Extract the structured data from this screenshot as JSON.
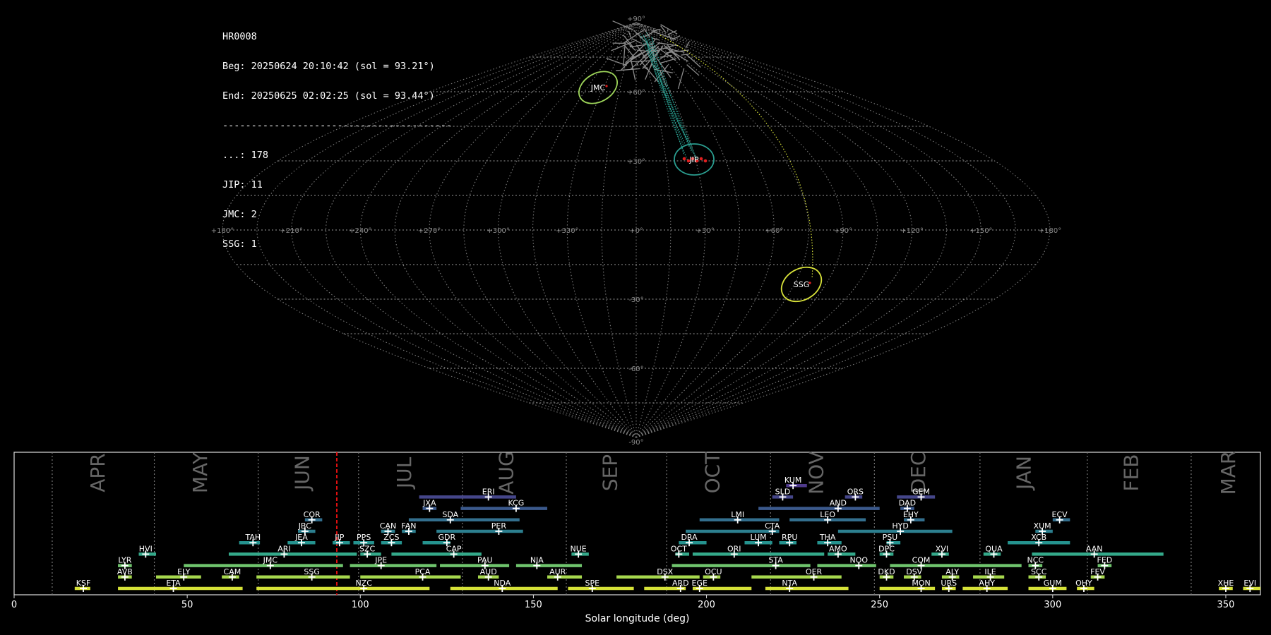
{
  "info": {
    "station": "HR0008",
    "begin": "Beg: 20250624 20:10:42 (sol = 93.21°)",
    "end": "End: 20250625 02:02:25 (sol = 93.44°)",
    "separator": "----------------------------------------",
    "counts": [
      "...: 178",
      "JIP: 11",
      "JMC: 2",
      "SSG: 1"
    ]
  },
  "chart_data": [
    {
      "type": "scatter",
      "projection": "sinusoidal",
      "lon_tick_labels": [
        "+180°",
        "+150°",
        "+120°",
        "+90°",
        "+60°",
        "+30°",
        "+0°",
        "+330°",
        "+300°",
        "+270°",
        "+240°",
        "+210°",
        "+180°"
      ],
      "lat_tick_labels": [
        "+90°",
        "+60°",
        "+30°",
        "-30°",
        "-60°",
        "-90°"
      ],
      "grid": true,
      "showers": [
        {
          "code": "JMC",
          "lon": 52,
          "lat": 60,
          "color": "#9ed65a"
        },
        {
          "code": "JIP",
          "lon": -18,
          "lat": 31,
          "color": "#2a9d8f"
        },
        {
          "code": "SSG",
          "lon": -72,
          "lat": -27,
          "color": "#d8e23a"
        }
      ]
    },
    {
      "type": "bar",
      "orientation": "horizontal-ranges",
      "xlabel": "Solar longitude (deg)",
      "xlim": [
        0,
        360
      ],
      "x_ticks": [
        0,
        50,
        100,
        150,
        200,
        250,
        300,
        350
      ],
      "current_sol": 93.21,
      "months": [
        {
          "name": "APR",
          "pos": 24.5
        },
        {
          "name": "MAY",
          "pos": 54
        },
        {
          "name": "JUN",
          "pos": 83.5
        },
        {
          "name": "JUL",
          "pos": 113
        },
        {
          "name": "AUG",
          "pos": 142.5
        },
        {
          "name": "SEP",
          "pos": 172.5
        },
        {
          "name": "OCT",
          "pos": 202
        },
        {
          "name": "NOV",
          "pos": 232
        },
        {
          "name": "DEC",
          "pos": 261.5
        },
        {
          "name": "JAN",
          "pos": 292
        },
        {
          "name": "FEB",
          "pos": 323
        },
        {
          "name": "MAR",
          "pos": 351
        }
      ],
      "month_boundaries": [
        11,
        40.5,
        70.5,
        99.5,
        129.5,
        159.5,
        188.5,
        218.5,
        248.5,
        279,
        310,
        340
      ],
      "showers": [
        {
          "code": "KSF",
          "start": 17.5,
          "end": 22,
          "peak": 20,
          "row": 0
        },
        {
          "code": "ETA",
          "start": 30,
          "end": 66,
          "peak": 46,
          "row": 0
        },
        {
          "code": "NZC",
          "start": 70,
          "end": 120,
          "peak": 101,
          "row": 0
        },
        {
          "code": "NDA",
          "start": 126,
          "end": 157,
          "peak": 141,
          "row": 0
        },
        {
          "code": "SPE",
          "start": 160,
          "end": 179,
          "peak": 167,
          "row": 0
        },
        {
          "code": "ARD",
          "start": 182,
          "end": 194,
          "peak": 192.5,
          "row": 0
        },
        {
          "code": "EGE",
          "start": 196,
          "end": 213,
          "peak": 198,
          "row": 0
        },
        {
          "code": "NTA",
          "start": 217,
          "end": 241,
          "peak": 224,
          "row": 0
        },
        {
          "code": "MON",
          "start": 250,
          "end": 266,
          "peak": 262,
          "row": 0
        },
        {
          "code": "URS",
          "start": 268,
          "end": 272,
          "peak": 270,
          "row": 0
        },
        {
          "code": "AHY",
          "start": 274,
          "end": 287,
          "peak": 281,
          "row": 0
        },
        {
          "code": "GUM",
          "start": 293,
          "end": 304,
          "peak": 300,
          "row": 0
        },
        {
          "code": "OHY",
          "start": 307,
          "end": 312,
          "peak": 309,
          "row": 0
        },
        {
          "code": "XHE",
          "start": 348,
          "end": 352,
          "peak": 350,
          "row": 0
        },
        {
          "code": "EVI",
          "start": 355,
          "end": 360,
          "peak": 357,
          "row": 0
        },
        {
          "code": "AVB",
          "start": 30,
          "end": 34,
          "peak": 32,
          "row": 1
        },
        {
          "code": "ELY",
          "start": 41,
          "end": 54,
          "peak": 49,
          "row": 1
        },
        {
          "code": "CAM",
          "start": 60,
          "end": 65,
          "peak": 63,
          "row": 1
        },
        {
          "code": "SSG",
          "start": 70,
          "end": 97,
          "peak": 86,
          "row": 1
        },
        {
          "code": "PCA",
          "start": 100,
          "end": 129,
          "peak": 118,
          "row": 1
        },
        {
          "code": "AUD",
          "start": 134,
          "end": 140,
          "peak": 137,
          "row": 1
        },
        {
          "code": "AUR",
          "start": 154,
          "end": 164,
          "peak": 157,
          "row": 1
        },
        {
          "code": "DSX",
          "start": 174,
          "end": 198,
          "peak": 188,
          "row": 1
        },
        {
          "code": "OCU",
          "start": 199,
          "end": 204,
          "peak": 202,
          "row": 1
        },
        {
          "code": "OER",
          "start": 213,
          "end": 239,
          "peak": 231,
          "row": 1
        },
        {
          "code": "DKD",
          "start": 250,
          "end": 254,
          "peak": 252,
          "row": 1
        },
        {
          "code": "DSV",
          "start": 257,
          "end": 262,
          "peak": 260,
          "row": 1
        },
        {
          "code": "ALY",
          "start": 268,
          "end": 273,
          "peak": 271,
          "row": 1
        },
        {
          "code": "ILE",
          "start": 277,
          "end": 286,
          "peak": 282,
          "row": 1
        },
        {
          "code": "SCC",
          "start": 293,
          "end": 298,
          "peak": 296,
          "row": 1
        },
        {
          "code": "FEV",
          "start": 311,
          "end": 315,
          "peak": 313,
          "row": 1
        },
        {
          "code": "LYR",
          "start": 30,
          "end": 34,
          "peak": 32,
          "row": 2
        },
        {
          "code": "JMC",
          "start": 49,
          "end": 95,
          "peak": 74,
          "row": 2
        },
        {
          "code": "JPE",
          "start": 97,
          "end": 122,
          "peak": 106,
          "row": 2
        },
        {
          "code": "PAU",
          "start": 123,
          "end": 143,
          "peak": 136,
          "row": 2
        },
        {
          "code": "NIA",
          "start": 145,
          "end": 164,
          "peak": 151,
          "row": 2
        },
        {
          "code": "STA",
          "start": 190,
          "end": 230,
          "peak": 220,
          "row": 2
        },
        {
          "code": "NOO",
          "start": 232,
          "end": 249,
          "peak": 244,
          "row": 2
        },
        {
          "code": "COM",
          "start": 253,
          "end": 291,
          "peak": 262,
          "row": 2
        },
        {
          "code": "NCC",
          "start": 293,
          "end": 297,
          "peak": 295,
          "row": 2
        },
        {
          "code": "FED",
          "start": 313,
          "end": 317,
          "peak": 315,
          "row": 2
        },
        {
          "code": "HVI",
          "start": 36,
          "end": 41,
          "peak": 38,
          "row": 3
        },
        {
          "code": "ARI",
          "start": 62,
          "end": 99,
          "peak": 78,
          "row": 3
        },
        {
          "code": "SZC",
          "start": 100,
          "end": 106,
          "peak": 102,
          "row": 3
        },
        {
          "code": "CAP",
          "start": 109,
          "end": 135,
          "peak": 127,
          "row": 3
        },
        {
          "code": "NUE",
          "start": 161,
          "end": 166,
          "peak": 163,
          "row": 3
        },
        {
          "code": "OCT",
          "start": 191,
          "end": 195,
          "peak": 192,
          "row": 3
        },
        {
          "code": "ORI",
          "start": 196,
          "end": 234,
          "peak": 208,
          "row": 3
        },
        {
          "code": "AMO",
          "start": 235,
          "end": 243,
          "peak": 238,
          "row": 3
        },
        {
          "code": "DPC",
          "start": 250,
          "end": 254,
          "peak": 252,
          "row": 3
        },
        {
          "code": "XVI",
          "start": 265,
          "end": 270,
          "peak": 268,
          "row": 3
        },
        {
          "code": "QUA",
          "start": 280,
          "end": 285,
          "peak": 283,
          "row": 3
        },
        {
          "code": "AAN",
          "start": 294,
          "end": 332,
          "peak": 312,
          "row": 3
        },
        {
          "code": "TAH",
          "start": 65,
          "end": 71,
          "peak": 69,
          "row": 4
        },
        {
          "code": "JEA",
          "start": 79,
          "end": 87,
          "peak": 83,
          "row": 4
        },
        {
          "code": "JIP",
          "start": 92,
          "end": 97,
          "peak": 94,
          "row": 4
        },
        {
          "code": "PPS",
          "start": 98,
          "end": 104,
          "peak": 101,
          "row": 4
        },
        {
          "code": "ZCS",
          "start": 106,
          "end": 112,
          "peak": 109,
          "row": 4
        },
        {
          "code": "GDR",
          "start": 118,
          "end": 126,
          "peak": 125,
          "row": 4
        },
        {
          "code": "DRA",
          "start": 192,
          "end": 200,
          "peak": 195,
          "row": 4
        },
        {
          "code": "LUM",
          "start": 211,
          "end": 219,
          "peak": 215,
          "row": 4
        },
        {
          "code": "RPU",
          "start": 221,
          "end": 226,
          "peak": 224,
          "row": 4
        },
        {
          "code": "THA",
          "start": 232,
          "end": 239,
          "peak": 235,
          "row": 4
        },
        {
          "code": "PSU",
          "start": 252,
          "end": 256,
          "peak": 253,
          "row": 4
        },
        {
          "code": "XCB",
          "start": 287,
          "end": 305,
          "peak": 296,
          "row": 4
        },
        {
          "code": "JBC",
          "start": 82,
          "end": 87,
          "peak": 84,
          "row": 5
        },
        {
          "code": "CAN",
          "start": 106,
          "end": 110,
          "peak": 108,
          "row": 5
        },
        {
          "code": "FAN",
          "start": 112,
          "end": 116,
          "peak": 114,
          "row": 5
        },
        {
          "code": "PER",
          "start": 122,
          "end": 147,
          "peak": 140,
          "row": 5
        },
        {
          "code": "CTA",
          "start": 194,
          "end": 221,
          "peak": 219,
          "row": 5
        },
        {
          "code": "HYD",
          "start": 238,
          "end": 271,
          "peak": 256,
          "row": 5
        },
        {
          "code": "XUM",
          "start": 295,
          "end": 300,
          "peak": 297,
          "row": 5
        },
        {
          "code": "COR",
          "start": 84,
          "end": 89,
          "peak": 86,
          "row": 6
        },
        {
          "code": "SDA",
          "start": 114,
          "end": 146,
          "peak": 126,
          "row": 6
        },
        {
          "code": "LMI",
          "start": 198,
          "end": 221,
          "peak": 209,
          "row": 6
        },
        {
          "code": "LEO",
          "start": 224,
          "end": 246,
          "peak": 235,
          "row": 6
        },
        {
          "code": "EHY",
          "start": 257,
          "end": 263,
          "peak": 259,
          "row": 6
        },
        {
          "code": "ECV",
          "start": 300,
          "end": 305,
          "peak": 302,
          "row": 6
        },
        {
          "code": "JXA",
          "start": 118,
          "end": 122,
          "peak": 120,
          "row": 7
        },
        {
          "code": "KCG",
          "start": 129,
          "end": 154,
          "peak": 145,
          "row": 7
        },
        {
          "code": "AND",
          "start": 215,
          "end": 250,
          "peak": 238,
          "row": 7
        },
        {
          "code": "DAD",
          "start": 256,
          "end": 260,
          "peak": 258,
          "row": 7
        },
        {
          "code": "ERI",
          "start": 117,
          "end": 145,
          "peak": 137,
          "row": 8
        },
        {
          "code": "SLD",
          "start": 219,
          "end": 225,
          "peak": 222,
          "row": 8
        },
        {
          "code": "ORS",
          "start": 240,
          "end": 245,
          "peak": 243,
          "row": 8
        },
        {
          "code": "GEM",
          "start": 255,
          "end": 266,
          "peak": 262,
          "row": 8
        },
        {
          "code": "KUM",
          "start": 223,
          "end": 229,
          "peak": 225,
          "row": 9
        }
      ]
    }
  ]
}
